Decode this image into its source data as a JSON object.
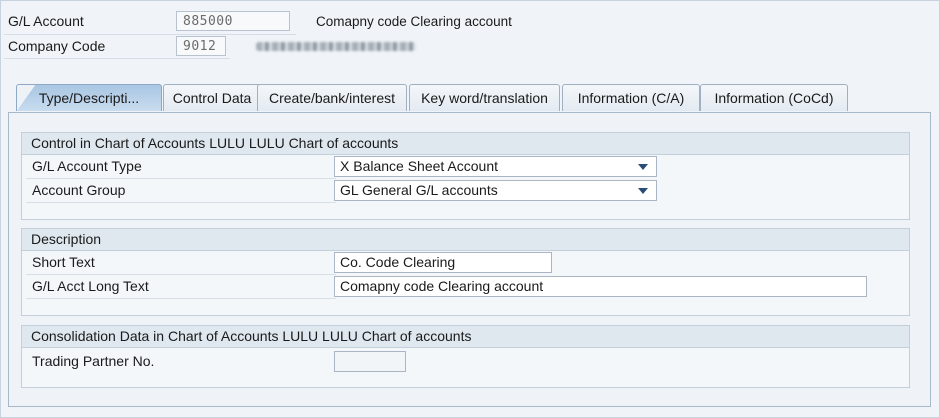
{
  "header": {
    "gl_account_label": "G/L Account",
    "gl_account_value": "885000",
    "gl_account_desc": "Comapny code Clearing account",
    "company_code_label": "Company Code",
    "company_code_value": "9012"
  },
  "tabs": [
    {
      "label": "Type/Descripti..."
    },
    {
      "label": "Control Data"
    },
    {
      "label": "Create/bank/interest"
    },
    {
      "label": "Key word/translation"
    },
    {
      "label": "Information (C/A)"
    },
    {
      "label": "Information (CoCd)"
    }
  ],
  "control_group": {
    "title": "Control in Chart of Accounts LULU LULU Chart of accounts",
    "account_type_label": "G/L Account Type",
    "account_type_value": "X Balance Sheet Account",
    "account_group_label": "Account Group",
    "account_group_value": "GL General G/L accounts"
  },
  "description_group": {
    "title": "Description",
    "short_text_label": "Short Text",
    "short_text_value": "Co. Code Clearing",
    "long_text_label": "G/L Acct Long Text",
    "long_text_value": "Comapny code Clearing account"
  },
  "consolidation_group": {
    "title": "Consolidation Data in Chart of Accounts LULU LULU Chart of accounts",
    "trading_partner_label": "Trading Partner No.",
    "trading_partner_value": ""
  },
  "icons": {
    "dropdown": "chevron-down-icon"
  }
}
